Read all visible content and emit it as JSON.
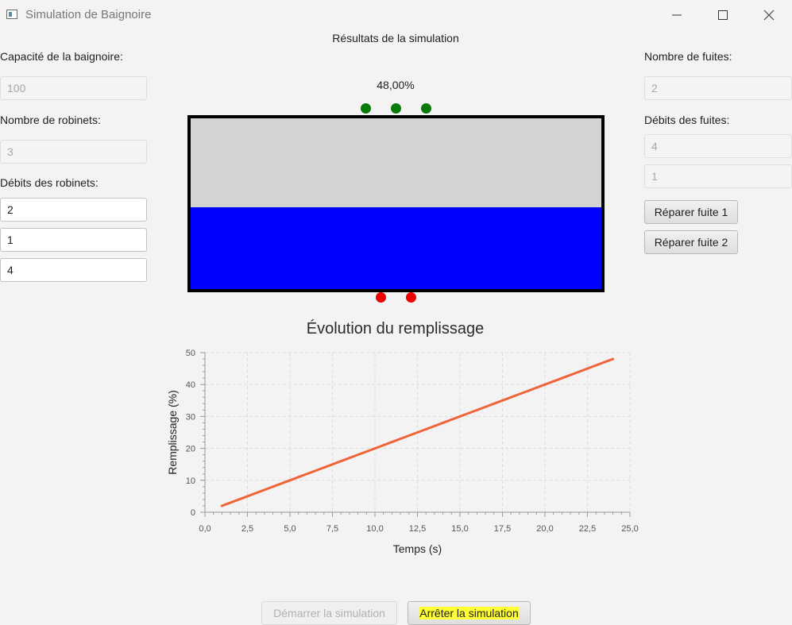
{
  "window": {
    "title": "Simulation de Baignoire",
    "icon": "app-window-icon"
  },
  "header": {
    "title": "Résultats de la simulation"
  },
  "left_panel": {
    "capacity_label": "Capacité de la baignoire:",
    "capacity_value": "100",
    "taps_count_label": "Nombre de robinets:",
    "taps_count_value": "3",
    "tap_rates_label": "Débits des robinets:",
    "tap_rates": [
      "2",
      "1",
      "4"
    ]
  },
  "right_panel": {
    "leaks_count_label": "Nombre de fuites:",
    "leaks_count_value": "2",
    "leak_rates_label": "Débits des fuites:",
    "leak_rates": [
      "4",
      "1"
    ],
    "repair_buttons": [
      "Réparer fuite 1",
      "Réparer fuite 2"
    ]
  },
  "tub": {
    "fill_text": "48,00%",
    "fill_fraction": 0.48,
    "taps": 3,
    "leaks": 2,
    "colors": {
      "water": "#0000ff",
      "empty": "#d3d3d3",
      "tap": "#0a7a0a",
      "leak": "#ee0000"
    }
  },
  "chart_data": {
    "type": "line",
    "title": "Évolution du remplissage",
    "xlabel": "Temps (s)",
    "ylabel": "Remplissage (%)",
    "xlim": [
      0,
      25
    ],
    "ylim": [
      0,
      50
    ],
    "xticks": [
      "0,0",
      "2,5",
      "5,0",
      "7,5",
      "10,0",
      "12,5",
      "15,0",
      "17,5",
      "20,0",
      "22,5",
      "25,0"
    ],
    "yticks": [
      "0",
      "10",
      "20",
      "30",
      "40",
      "50"
    ],
    "grid": true,
    "series": [
      {
        "color": "#f0643a",
        "x": [
          1,
          2,
          3,
          4,
          5,
          6,
          7,
          8,
          9,
          10,
          11,
          12,
          13,
          14,
          15,
          16,
          17,
          18,
          19,
          20,
          21,
          22,
          23,
          24
        ],
        "y": [
          2,
          4,
          6,
          8,
          10,
          12,
          14,
          16,
          18,
          20,
          22,
          24,
          26,
          28,
          30,
          32,
          34,
          36,
          38,
          40,
          42,
          44,
          46,
          48
        ]
      }
    ]
  },
  "footer": {
    "start_label": "Démarrer la simulation",
    "start_enabled": false,
    "stop_label": "Arrêter la simulation"
  }
}
